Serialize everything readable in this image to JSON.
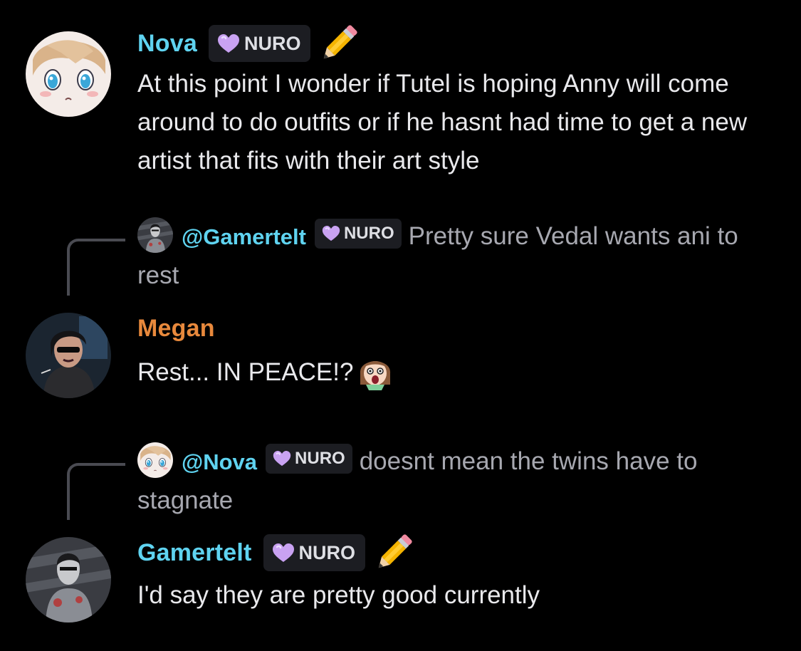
{
  "colors": {
    "background": "#000000",
    "name_cyan": "#5fd3f0",
    "name_orange": "#e8893c",
    "tag_bg": "#1c1d22",
    "heart_purple": "#c9a2f2",
    "reply_text": "#a7a8b0"
  },
  "messages": [
    {
      "author": "Nova",
      "author_color": "#5fd3f0",
      "tag": "NURO",
      "tag_icon": "purple-heart-icon",
      "extra_icon": "pencil-icon",
      "avatar_icon": "anime-girl-avatar",
      "text": "At this point I wonder if Tutel is hoping Anny will come around to do outfits or if he hasnt had time to get a new artist that fits with their art style"
    },
    {
      "reply_to": {
        "mention": "@Gamertelt",
        "tag": "NURO",
        "text": "Pretty sure Vedal wants ani to rest",
        "avatar_icon": "dark-figure-avatar"
      },
      "author": "Megan",
      "author_color": "#e8893c",
      "avatar_icon": "woman-sunglasses-avatar",
      "text": "Rest... IN PEACE!?",
      "emoji": "shocked-girl-emoji"
    },
    {
      "reply_to": {
        "mention": "@Nova",
        "tag": "NURO",
        "text": "doesnt mean the twins have to stagnate",
        "avatar_icon": "anime-girl-avatar"
      },
      "author": "Gamertelt",
      "author_color": "#5fd3f0",
      "tag": "NURO",
      "tag_icon": "purple-heart-icon",
      "extra_icon": "pencil-icon",
      "avatar_icon": "dark-figure-avatar",
      "text": "I'd say they are pretty good currently"
    }
  ]
}
